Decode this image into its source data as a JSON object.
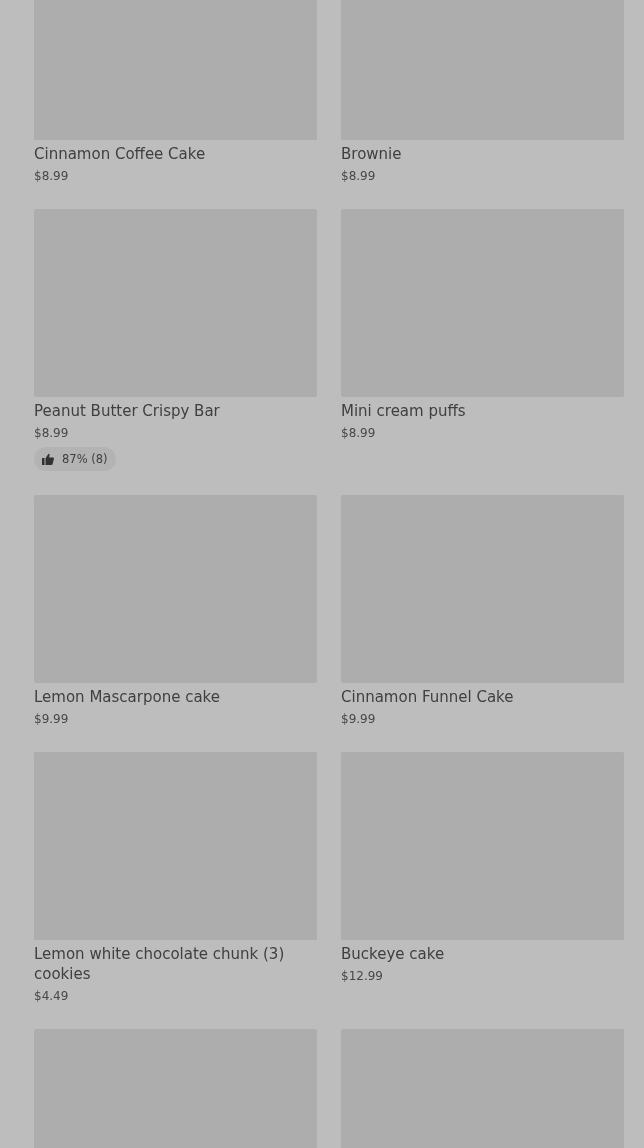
{
  "products": [
    {
      "kind": "product",
      "name": "Cinnamon Coffee Cake",
      "price": "$8.99"
    },
    {
      "kind": "product",
      "name": "Brownie",
      "price": "$8.99"
    },
    {
      "kind": "product",
      "name": "Peanut Butter Crispy Bar",
      "price": "$8.99",
      "rating": "87% (8)"
    },
    {
      "kind": "product",
      "name": "Mini cream puffs",
      "price": "$8.99"
    },
    {
      "kind": "product",
      "name": "Lemon Mascarpone cake",
      "price": "$9.99"
    },
    {
      "kind": "product",
      "name": "Cinnamon Funnel Cake",
      "price": "$9.99"
    },
    {
      "kind": "product",
      "name": "Lemon white chocolate chunk (3) cookies",
      "price": "$4.49"
    },
    {
      "kind": "product",
      "name": "Buckeye cake",
      "price": "$12.99"
    },
    {
      "kind": "picture"
    },
    {
      "kind": "picture"
    }
  ]
}
